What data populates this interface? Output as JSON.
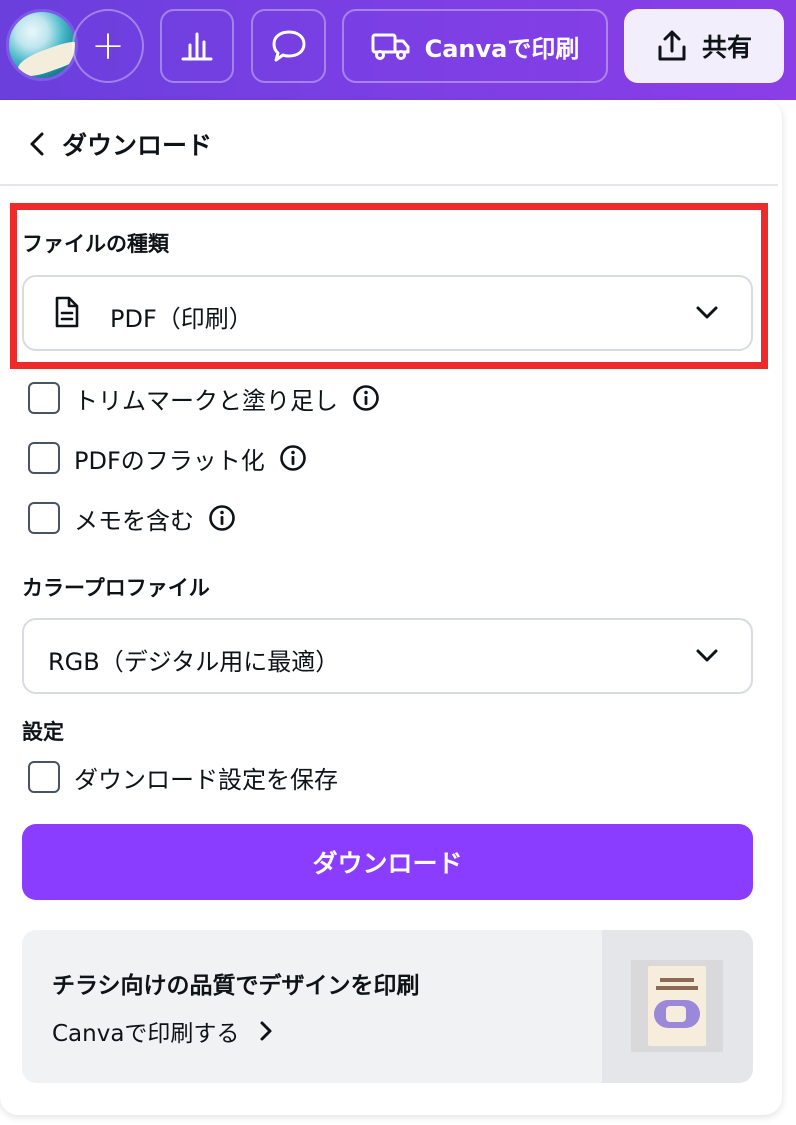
{
  "toolbar": {
    "add_label": "+",
    "print_label": "Canvaで印刷",
    "share_label": "共有"
  },
  "panel": {
    "title": "ダウンロード",
    "file_type": {
      "label": "ファイルの種類",
      "selected": "PDF（印刷）"
    },
    "options": [
      {
        "label": "トリムマークと塗り足し",
        "checked": false,
        "has_info": true
      },
      {
        "label": "PDFのフラット化",
        "checked": false,
        "has_info": true
      },
      {
        "label": "メモを含む",
        "checked": false,
        "has_info": true
      }
    ],
    "color_profile": {
      "label": "カラープロファイル",
      "selected": "RGB（デジタル用に最適）"
    },
    "settings": {
      "label": "設定",
      "save_label": "ダウンロード設定を保存",
      "checked": false
    },
    "download_button": "ダウンロード",
    "promo": {
      "title": "チラシ向けの品質でデザインを印刷",
      "link": "Canvaで印刷する"
    }
  },
  "colors": {
    "accent": "#8b3dff",
    "highlight": "#ee2a2a",
    "toolbar": "#7a3fe4"
  }
}
